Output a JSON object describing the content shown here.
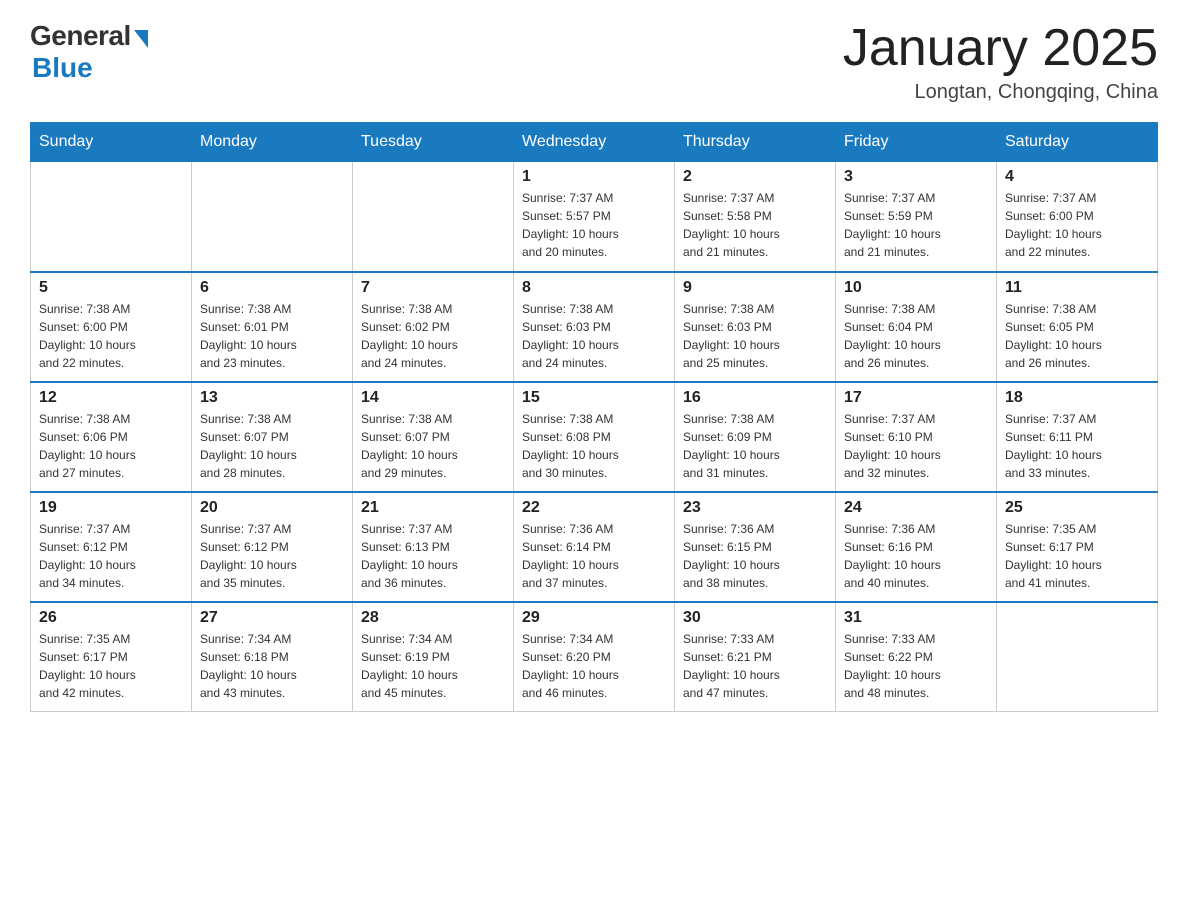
{
  "header": {
    "logo": {
      "general": "General",
      "blue": "Blue"
    },
    "title": "January 2025",
    "location": "Longtan, Chongqing, China"
  },
  "weekdays": [
    "Sunday",
    "Monday",
    "Tuesday",
    "Wednesday",
    "Thursday",
    "Friday",
    "Saturday"
  ],
  "weeks": [
    [
      {
        "day": "",
        "info": ""
      },
      {
        "day": "",
        "info": ""
      },
      {
        "day": "",
        "info": ""
      },
      {
        "day": "1",
        "info": "Sunrise: 7:37 AM\nSunset: 5:57 PM\nDaylight: 10 hours\nand 20 minutes."
      },
      {
        "day": "2",
        "info": "Sunrise: 7:37 AM\nSunset: 5:58 PM\nDaylight: 10 hours\nand 21 minutes."
      },
      {
        "day": "3",
        "info": "Sunrise: 7:37 AM\nSunset: 5:59 PM\nDaylight: 10 hours\nand 21 minutes."
      },
      {
        "day": "4",
        "info": "Sunrise: 7:37 AM\nSunset: 6:00 PM\nDaylight: 10 hours\nand 22 minutes."
      }
    ],
    [
      {
        "day": "5",
        "info": "Sunrise: 7:38 AM\nSunset: 6:00 PM\nDaylight: 10 hours\nand 22 minutes."
      },
      {
        "day": "6",
        "info": "Sunrise: 7:38 AM\nSunset: 6:01 PM\nDaylight: 10 hours\nand 23 minutes."
      },
      {
        "day": "7",
        "info": "Sunrise: 7:38 AM\nSunset: 6:02 PM\nDaylight: 10 hours\nand 24 minutes."
      },
      {
        "day": "8",
        "info": "Sunrise: 7:38 AM\nSunset: 6:03 PM\nDaylight: 10 hours\nand 24 minutes."
      },
      {
        "day": "9",
        "info": "Sunrise: 7:38 AM\nSunset: 6:03 PM\nDaylight: 10 hours\nand 25 minutes."
      },
      {
        "day": "10",
        "info": "Sunrise: 7:38 AM\nSunset: 6:04 PM\nDaylight: 10 hours\nand 26 minutes."
      },
      {
        "day": "11",
        "info": "Sunrise: 7:38 AM\nSunset: 6:05 PM\nDaylight: 10 hours\nand 26 minutes."
      }
    ],
    [
      {
        "day": "12",
        "info": "Sunrise: 7:38 AM\nSunset: 6:06 PM\nDaylight: 10 hours\nand 27 minutes."
      },
      {
        "day": "13",
        "info": "Sunrise: 7:38 AM\nSunset: 6:07 PM\nDaylight: 10 hours\nand 28 minutes."
      },
      {
        "day": "14",
        "info": "Sunrise: 7:38 AM\nSunset: 6:07 PM\nDaylight: 10 hours\nand 29 minutes."
      },
      {
        "day": "15",
        "info": "Sunrise: 7:38 AM\nSunset: 6:08 PM\nDaylight: 10 hours\nand 30 minutes."
      },
      {
        "day": "16",
        "info": "Sunrise: 7:38 AM\nSunset: 6:09 PM\nDaylight: 10 hours\nand 31 minutes."
      },
      {
        "day": "17",
        "info": "Sunrise: 7:37 AM\nSunset: 6:10 PM\nDaylight: 10 hours\nand 32 minutes."
      },
      {
        "day": "18",
        "info": "Sunrise: 7:37 AM\nSunset: 6:11 PM\nDaylight: 10 hours\nand 33 minutes."
      }
    ],
    [
      {
        "day": "19",
        "info": "Sunrise: 7:37 AM\nSunset: 6:12 PM\nDaylight: 10 hours\nand 34 minutes."
      },
      {
        "day": "20",
        "info": "Sunrise: 7:37 AM\nSunset: 6:12 PM\nDaylight: 10 hours\nand 35 minutes."
      },
      {
        "day": "21",
        "info": "Sunrise: 7:37 AM\nSunset: 6:13 PM\nDaylight: 10 hours\nand 36 minutes."
      },
      {
        "day": "22",
        "info": "Sunrise: 7:36 AM\nSunset: 6:14 PM\nDaylight: 10 hours\nand 37 minutes."
      },
      {
        "day": "23",
        "info": "Sunrise: 7:36 AM\nSunset: 6:15 PM\nDaylight: 10 hours\nand 38 minutes."
      },
      {
        "day": "24",
        "info": "Sunrise: 7:36 AM\nSunset: 6:16 PM\nDaylight: 10 hours\nand 40 minutes."
      },
      {
        "day": "25",
        "info": "Sunrise: 7:35 AM\nSunset: 6:17 PM\nDaylight: 10 hours\nand 41 minutes."
      }
    ],
    [
      {
        "day": "26",
        "info": "Sunrise: 7:35 AM\nSunset: 6:17 PM\nDaylight: 10 hours\nand 42 minutes."
      },
      {
        "day": "27",
        "info": "Sunrise: 7:34 AM\nSunset: 6:18 PM\nDaylight: 10 hours\nand 43 minutes."
      },
      {
        "day": "28",
        "info": "Sunrise: 7:34 AM\nSunset: 6:19 PM\nDaylight: 10 hours\nand 45 minutes."
      },
      {
        "day": "29",
        "info": "Sunrise: 7:34 AM\nSunset: 6:20 PM\nDaylight: 10 hours\nand 46 minutes."
      },
      {
        "day": "30",
        "info": "Sunrise: 7:33 AM\nSunset: 6:21 PM\nDaylight: 10 hours\nand 47 minutes."
      },
      {
        "day": "31",
        "info": "Sunrise: 7:33 AM\nSunset: 6:22 PM\nDaylight: 10 hours\nand 48 minutes."
      },
      {
        "day": "",
        "info": ""
      }
    ]
  ]
}
